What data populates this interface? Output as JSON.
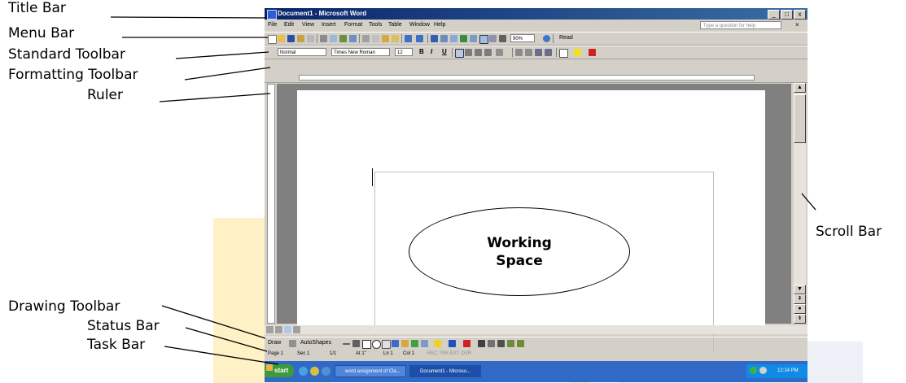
{
  "callouts": {
    "title_bar": "Title Bar",
    "menu_bar": "Menu Bar",
    "standard_toolbar": "Standard Toolbar",
    "formatting_toolbar": "Formatting Toolbar",
    "ruler": "Ruler",
    "scroll_bar": "Scroll Bar",
    "drawing_toolbar": "Drawing Toolbar",
    "status_bar": "Status Bar",
    "task_bar": "Task Bar"
  },
  "working_space": {
    "line1": "Working",
    "line2": "Space"
  },
  "window": {
    "title": "Document1 - Microsoft Word",
    "buttons": {
      "minimize": "_",
      "maximize": "□",
      "close": "x"
    }
  },
  "menu": {
    "items": [
      "File",
      "Edit",
      "View",
      "Insert",
      "Format",
      "Tools",
      "Table",
      "Window",
      "Help"
    ],
    "help_placeholder": "Type a question for help",
    "doc_close": "×"
  },
  "standard_toolbar": {
    "zoom": "90%",
    "read_button": "Read"
  },
  "formatting_toolbar": {
    "style": "Normal",
    "font": "Times New Roman",
    "size": "12",
    "bold": "B",
    "italic": "I",
    "underline": "U"
  },
  "drawing_toolbar": {
    "draw_label": "Draw",
    "autoshapes_label": "AutoShapes"
  },
  "status_bar": {
    "page": "Page 1",
    "section": "Sec 1",
    "page_count": "1/1",
    "at": "At 1\"",
    "line": "Ln 1",
    "col": "Col 1",
    "modes": "REC TRK EXT OVR"
  },
  "taskbar": {
    "start_label": "start",
    "tasks": [
      "word assignment of Cla...",
      "Document1 - Microso..."
    ],
    "clock": "12:14 PM"
  },
  "colors": {
    "title_bar": "#0a246a",
    "taskbar": "#3169c6",
    "start_button": "#3c9a3c",
    "chrome": "#d4d0c8",
    "document_background": "#808080",
    "watermark": "#fff1c6"
  },
  "icons": {
    "app": "word-app-icon",
    "standard_toolbar": [
      "new-document-icon",
      "open-folder-icon",
      "save-icon",
      "permission-icon",
      "email-icon",
      "print-icon",
      "print-preview-icon",
      "spelling-icon",
      "research-icon",
      "cut-icon",
      "copy-icon",
      "paste-icon",
      "format-painter-icon",
      "undo-icon",
      "redo-icon",
      "hyperlink-icon",
      "tables-borders-icon",
      "insert-table-icon",
      "insert-excel-icon",
      "columns-icon",
      "drawing-icon",
      "document-map-icon",
      "show-hide-icon",
      "help-icon"
    ],
    "formatting_toolbar": [
      "align-left-icon",
      "align-center-icon",
      "align-right-icon",
      "justify-icon",
      "line-spacing-icon",
      "numbering-icon",
      "bullets-icon",
      "decrease-indent-icon",
      "increase-indent-icon",
      "border-icon",
      "highlight-icon",
      "font-color-icon"
    ],
    "drawing_toolbar": [
      "line-icon",
      "arrow-icon",
      "rectangle-icon",
      "oval-icon",
      "text-box-icon",
      "wordart-icon",
      "diagram-icon",
      "clip-art-icon",
      "picture-icon",
      "fill-color-icon",
      "line-color-icon",
      "font-color-icon",
      "line-style-icon",
      "dash-style-icon",
      "arrow-style-icon",
      "shadow-icon",
      "3d-icon"
    ],
    "taskbar": [
      "start-logo-icon",
      "ie-icon",
      "show-desktop-icon",
      "media-player-icon",
      "word-task-icon",
      "word-task-icon",
      "network-icon",
      "volume-icon"
    ]
  }
}
